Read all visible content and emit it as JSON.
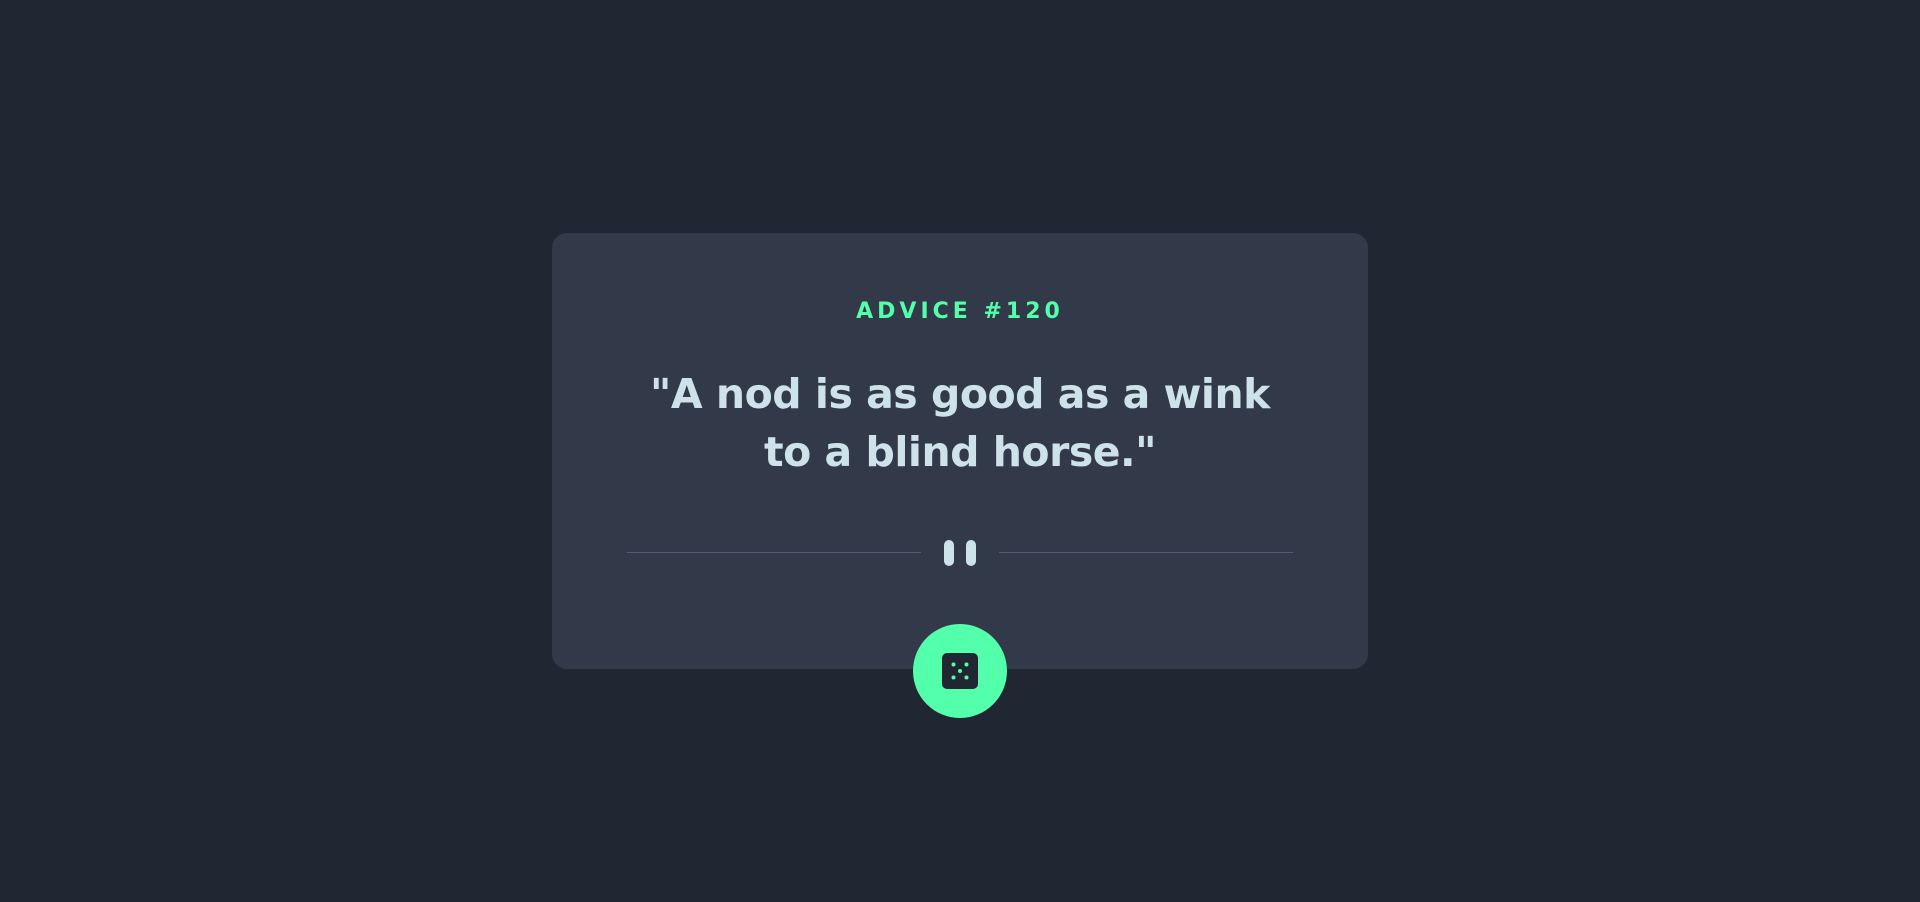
{
  "advice": {
    "id_label": "ADVICE #120",
    "quote": "\"A nod is as good as a wink to a blind horse.\""
  },
  "icons": {
    "divider": "pause-icon",
    "button": "dice-icon"
  },
  "colors": {
    "background": "#202733",
    "card": "#323a49",
    "accent": "#53ffaa",
    "text": "#cee3e9",
    "divider": "#4f5d74"
  }
}
